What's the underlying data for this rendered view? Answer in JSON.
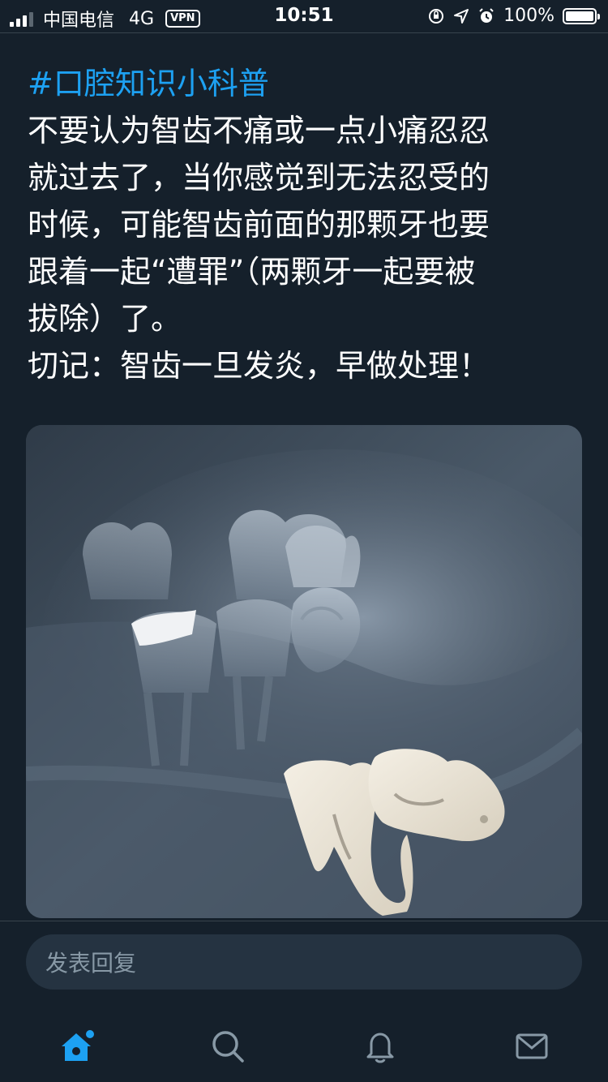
{
  "status_bar": {
    "carrier": "中国电信",
    "network": "4G",
    "vpn": "VPN",
    "time": "10:51",
    "battery": "100%"
  },
  "post": {
    "hashtag": "#口腔知识小科普",
    "lines": [
      "不要认为智齿不痛或一点小痛忍忍",
      "就过去了，当你感觉到无法忍受的",
      "时候，可能智齿前面的那颗牙也要",
      "跟着一起“遭罪”（两颗牙一起要被",
      "拔除）了。",
      "切记：智齿一旦发炎，早做处理！"
    ]
  },
  "reply": {
    "placeholder": "发表回复"
  },
  "tabbar": {
    "items": [
      "home-icon",
      "search-icon",
      "notifications-icon",
      "messages-icon"
    ],
    "active": "home-icon"
  },
  "colors": {
    "background": "#15202b",
    "accent": "#1da1f2",
    "muted": "#8899a6",
    "input_bg": "#253341"
  }
}
